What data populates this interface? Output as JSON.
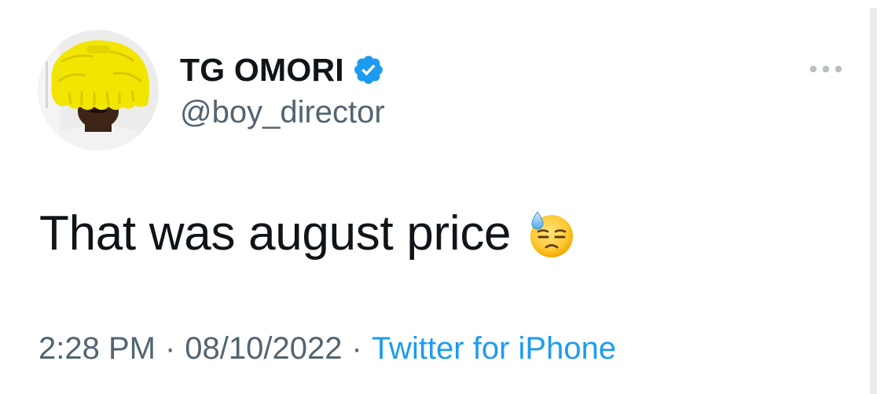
{
  "user": {
    "display_name": "TG OMORI",
    "handle": "@boy_director",
    "verified": true,
    "avatar_icon": "profile-photo-yellow-wig"
  },
  "tweet": {
    "text": "That was august price",
    "emoji": "downcast-face-with-sweat"
  },
  "meta": {
    "time": "2:28 PM",
    "separator": "·",
    "date": "08/10/2022",
    "source": "Twitter for iPhone"
  },
  "icons": {
    "verified": "verified-badge-icon",
    "more": "more-options-icon"
  },
  "colors": {
    "text_primary": "#0f1419",
    "text_secondary": "#536471",
    "link": "#1d9bf0",
    "verified": "#1d9bf0"
  }
}
